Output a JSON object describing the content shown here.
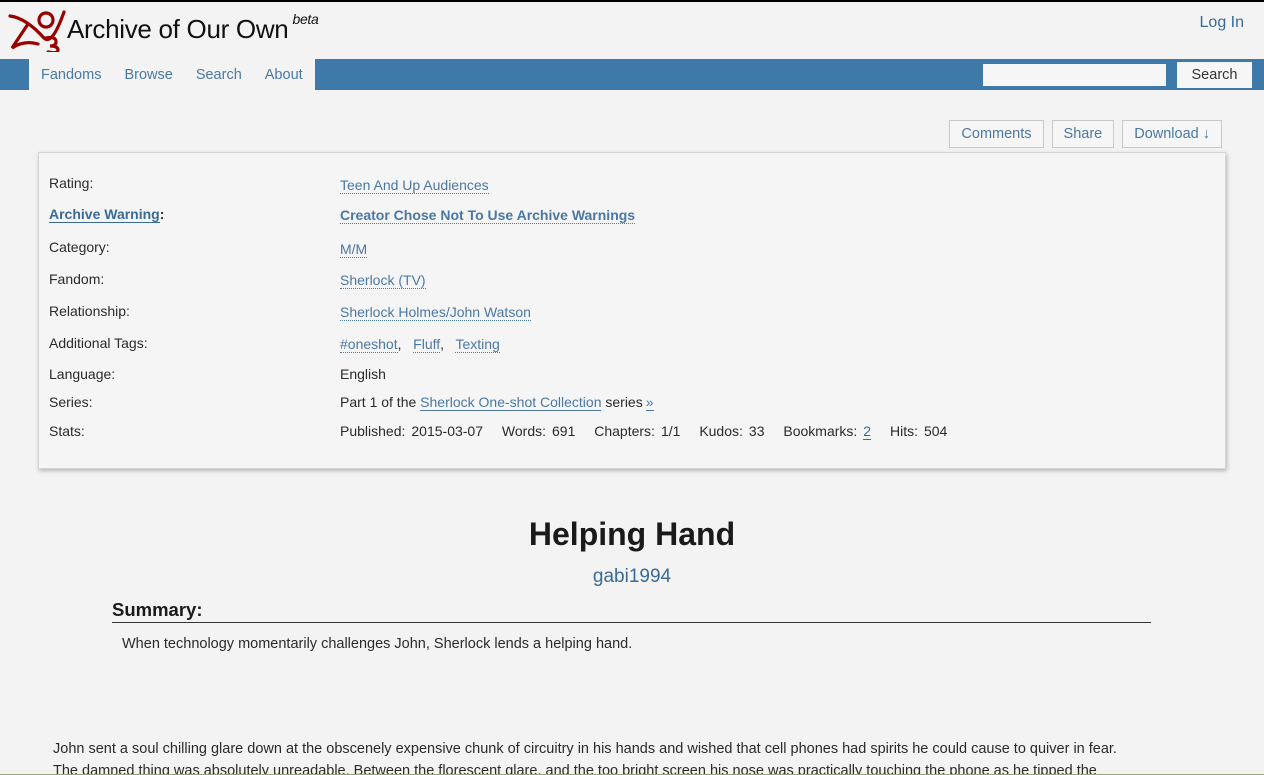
{
  "header": {
    "site_title": "Archive of Our Own",
    "site_badge": "beta",
    "login_label": "Log In",
    "logo_icon": "ao3-logo-icon"
  },
  "nav": {
    "items": [
      {
        "label": "Fandoms"
      },
      {
        "label": "Browse"
      },
      {
        "label": "Search"
      },
      {
        "label": "About"
      }
    ],
    "search": {
      "value": "",
      "placeholder": "",
      "button_label": "Search"
    }
  },
  "actions": {
    "comments_label": "Comments",
    "share_label": "Share",
    "download_label": "Download ↓"
  },
  "meta": {
    "rating": {
      "label": "Rating:",
      "value": "Teen And Up Audiences"
    },
    "warning": {
      "label": "Archive Warning",
      "label_suffix": ":",
      "value": "Creator Chose Not To Use Archive Warnings"
    },
    "category": {
      "label": "Category:",
      "value": "M/M"
    },
    "fandom": {
      "label": "Fandom:",
      "value": "Sherlock (TV)"
    },
    "relationship": {
      "label": "Relationship:",
      "value": "Sherlock Holmes/John Watson"
    },
    "additional_tags": {
      "label": "Additional Tags:",
      "tags": [
        "#oneshot",
        "Fluff",
        "Texting"
      ]
    },
    "language": {
      "label": "Language:",
      "value": "English"
    },
    "series": {
      "label": "Series:",
      "prefix": "Part 1 of the",
      "name": "Sherlock One-shot Collection",
      "suffix": "series",
      "next": "»"
    },
    "stats": {
      "label": "Stats:",
      "published_label": "Published:",
      "published": "2015-03-07",
      "words_label": "Words:",
      "words": "691",
      "chapters_label": "Chapters:",
      "chapters": "1/1",
      "kudos_label": "Kudos:",
      "kudos": "33",
      "bookmarks_label": "Bookmarks:",
      "bookmarks": "2",
      "hits_label": "Hits:",
      "hits": "504"
    }
  },
  "work": {
    "title": "Helping Hand",
    "author": "gabi1994",
    "summary_heading": "Summary:",
    "summary": "When technology momentarily challenges John, Sherlock lends a helping hand.",
    "body_line1": "John sent a soul chilling glare down at the obscenely expensive chunk of circuitry in his hands and wished that cell phones had spirits he could cause to quiver in fear.",
    "body_line2": "The damned thing was absolutely unreadable. Between the florescent glare, and the too bright screen his nose was practically touching the phone as he tipped the"
  }
}
